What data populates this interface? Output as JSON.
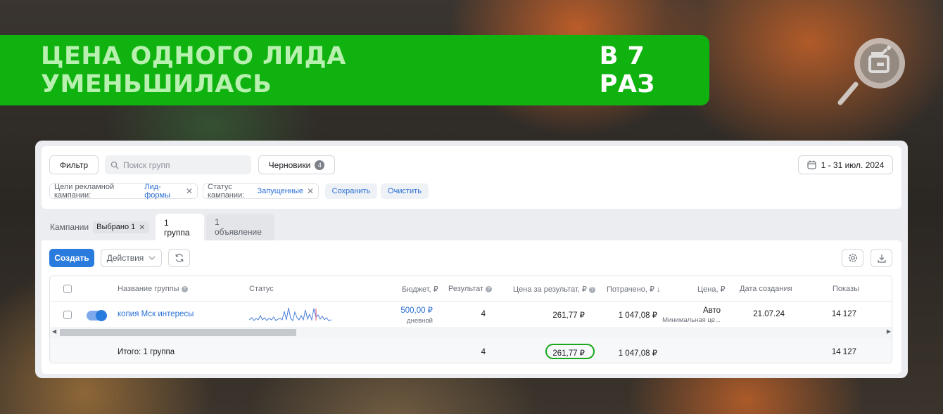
{
  "banner": {
    "title_part1": "ЦЕНА ОДНОГО ЛИДА УМЕНЬШИЛАСЬ",
    "title_part2": "В 7 РАЗ"
  },
  "toolbar": {
    "filter_label": "Фильтр",
    "search_placeholder": "Поиск групп",
    "drafts_label": "Черновики",
    "drafts_count": "4",
    "date_range": "1 - 31 июл. 2024"
  },
  "filters": {
    "chip1_key": "Цели рекламной кампании:",
    "chip1_value": "Лид-формы",
    "chip2_key": "Статус кампании:",
    "chip2_value": "Запущенные",
    "save_label": "Сохранить",
    "clear_label": "Очистить"
  },
  "tabs": {
    "campaigns": "Кампании",
    "selected": "Выбрано 1",
    "groups": "1 группа",
    "ads": "1 объявление"
  },
  "actions": {
    "create_label": "Создать",
    "actions_label": "Действия"
  },
  "table": {
    "headers": {
      "name": "Название группы",
      "status": "Статус",
      "budget": "Бюджет, ₽",
      "result": "Результат",
      "cost_per_result": "Цена за результат, ₽",
      "spent": "Потрачено, ₽",
      "price": "Цена, ₽",
      "created": "Дата создания",
      "impressions": "Показы"
    },
    "row": {
      "name": "копия Мск интересы",
      "budget": "500,00 ₽",
      "budget_period": "дневной",
      "result": "4",
      "cost_per_result": "261,77 ₽",
      "spent": "1 047,08 ₽",
      "price": "Авто",
      "price_sub": "Минимальная це...",
      "created": "21.07.24",
      "impressions": "14 127"
    },
    "total": {
      "label": "Итого: 1 группа",
      "result": "4",
      "cost_per_result": "261,77 ₽",
      "spent": "1 047,08 ₽",
      "impressions": "14 127"
    }
  },
  "colors": {
    "banner_green": "#10b210",
    "accent_blue": "#2a7bde",
    "highlight_green": "#18a818"
  }
}
